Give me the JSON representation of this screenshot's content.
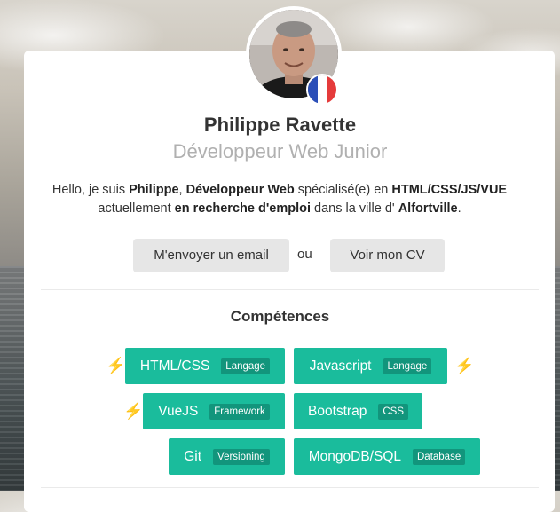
{
  "profile": {
    "name": "Philippe Ravette",
    "title": "Développeur Web Junior",
    "bio": {
      "p1": "Hello, je suis ",
      "b1": "Philippe",
      "p2": ", ",
      "b2": "Développeur Web",
      "p3": " spécialisé(e) en ",
      "b3": "HTML/CSS/JS/VUE",
      "p4": " actuellement ",
      "b4": "en recherche d'emploi",
      "p5": " dans la ville d' ",
      "b5": "Alfortville",
      "p6": "."
    }
  },
  "actions": {
    "email_label": "M'envoyer un email",
    "or_label": "ou",
    "cv_label": "Voir mon CV"
  },
  "skills_section": {
    "title": "Compétences",
    "items": [
      {
        "name": "HTML/CSS",
        "tag": "Langage",
        "highlight": true
      },
      {
        "name": "Javascript",
        "tag": "Langage",
        "highlight": true
      },
      {
        "name": "VueJS",
        "tag": "Framework",
        "highlight": true
      },
      {
        "name": "Bootstrap",
        "tag": "CSS",
        "highlight": false
      },
      {
        "name": "Git",
        "tag": "Versioning",
        "highlight": false
      },
      {
        "name": "MongoDB/SQL",
        "tag": "Database",
        "highlight": false
      }
    ]
  },
  "icons": {
    "highlight": "lightning-bolt-icon",
    "flag": "france-flag-icon"
  },
  "colors": {
    "accent": "#1abc9c",
    "tag_bg": "#12957c",
    "bolt": "#f1c40f",
    "button_bg": "#e6e6e6"
  }
}
